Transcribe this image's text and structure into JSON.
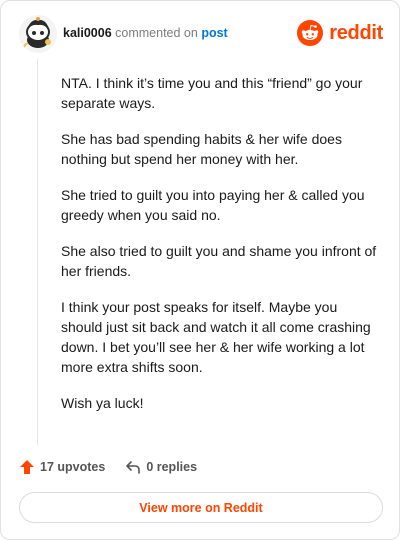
{
  "header": {
    "username": "kali0006",
    "verb": "commented on",
    "post_link": "post",
    "brand": "reddit"
  },
  "comment": {
    "paragraphs": [
      "NTA. I think it’s time you and this “friend” go your separate ways.",
      "She has bad spending habits & her wife does nothing but spend her money with her.",
      "She tried to guilt you into paying her & called you greedy when you said no.",
      "She also tried to guilt you and shame you infront of her friends.",
      "I think your post speaks for itself. Maybe you should just sit back and watch it all come crashing down. I bet you’ll see her & her wife working a lot more extra shifts soon.",
      "Wish ya luck!"
    ]
  },
  "actions": {
    "upvotes": "17 upvotes",
    "replies": "0 replies"
  },
  "cta": {
    "label": "View more on Reddit"
  },
  "colors": {
    "brand": "#ff4500",
    "link": "#0079d3"
  }
}
